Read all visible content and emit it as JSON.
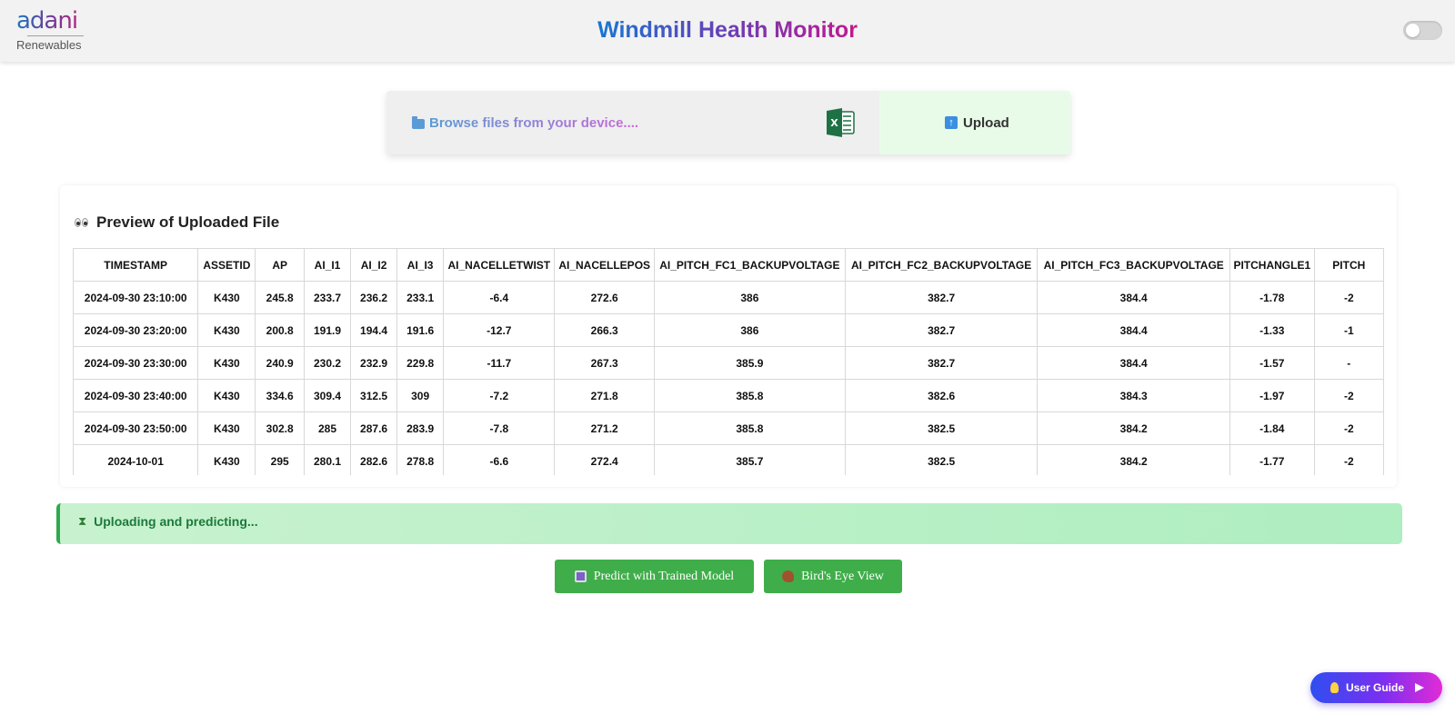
{
  "header": {
    "logo_word": "adani",
    "logo_sub": "Renewables",
    "title": "Windmill Health Monitor"
  },
  "upload": {
    "browse_label": "Browse files from your device....",
    "upload_label": "Upload"
  },
  "preview": {
    "title": "Preview of Uploaded File",
    "columns": [
      "TIMESTAMP",
      "ASSETID",
      "AP",
      "AI_I1",
      "AI_I2",
      "AI_I3",
      "AI_NACELLETWIST",
      "AI_NACELLEPOS",
      "AI_PITCH_FC1_BACKUPVOLTAGE",
      "AI_PITCH_FC2_BACKUPVOLTAGE",
      "AI_PITCH_FC3_BACKUPVOLTAGE",
      "PITCHANGLE1",
      "PITCH"
    ],
    "rows": [
      [
        "2024-09-30 23:10:00",
        "K430",
        "245.8",
        "233.7",
        "236.2",
        "233.1",
        "-6.4",
        "272.6",
        "386",
        "382.7",
        "384.4",
        "-1.78",
        "-2"
      ],
      [
        "2024-09-30 23:20:00",
        "K430",
        "200.8",
        "191.9",
        "194.4",
        "191.6",
        "-12.7",
        "266.3",
        "386",
        "382.7",
        "384.4",
        "-1.33",
        "-1"
      ],
      [
        "2024-09-30 23:30:00",
        "K430",
        "240.9",
        "230.2",
        "232.9",
        "229.8",
        "-11.7",
        "267.3",
        "385.9",
        "382.7",
        "384.4",
        "-1.57",
        "-"
      ],
      [
        "2024-09-30 23:40:00",
        "K430",
        "334.6",
        "309.4",
        "312.5",
        "309",
        "-7.2",
        "271.8",
        "385.8",
        "382.6",
        "384.3",
        "-1.97",
        "-2"
      ],
      [
        "2024-09-30 23:50:00",
        "K430",
        "302.8",
        "285",
        "287.6",
        "283.9",
        "-7.8",
        "271.2",
        "385.8",
        "382.5",
        "384.2",
        "-1.84",
        "-2"
      ],
      [
        "2024-10-01",
        "K430",
        "295",
        "280.1",
        "282.6",
        "278.8",
        "-6.6",
        "272.4",
        "385.7",
        "382.5",
        "384.2",
        "-1.77",
        "-2"
      ]
    ]
  },
  "status": {
    "text": "Uploading and predicting..."
  },
  "actions": {
    "predict_label": "Predict with Trained Model",
    "bird_label": "Bird's Eye View"
  },
  "guide": {
    "label": "User Guide"
  },
  "icons": {
    "browse": "folder-icon",
    "excel": "excel-icon",
    "upload": "upload-arrow-icon",
    "preview": "eyes-icon",
    "status": "loading-icon",
    "predict": "robot-icon",
    "bird": "bird-icon",
    "guide_left": "lightbulb-icon",
    "guide_right": "send-icon"
  },
  "colors": {
    "accent_green": "#3fae4a",
    "status_green": "#2fa84f",
    "upload_bg": "#e8fbe8"
  }
}
